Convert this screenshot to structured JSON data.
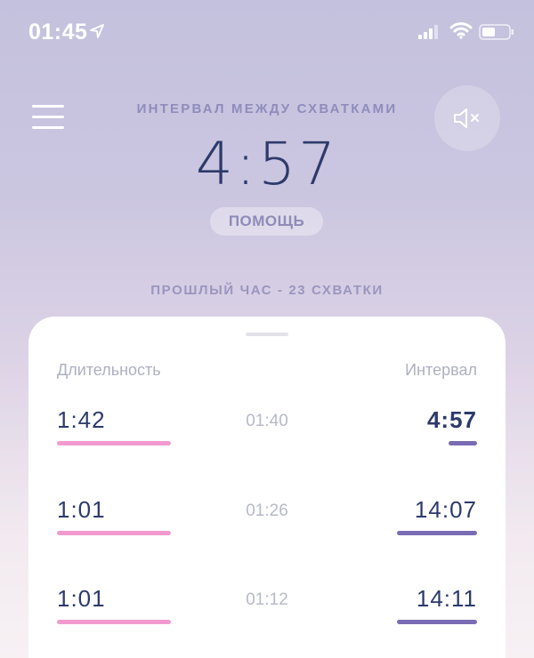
{
  "status_bar": {
    "time": "01:45"
  },
  "header": {
    "interval_label": "ИНТЕРВАЛ МЕЖДУ СХВАТКАМИ",
    "interval_value": "4:57",
    "help_label": "ПОМОЩЬ",
    "last_hour_summary": "ПРОШЛЫЙ ЧАС - 23 СХВАТКИ"
  },
  "table": {
    "duration_header": "Длительность",
    "interval_header": "Интервал",
    "rows": [
      {
        "duration": "1:42",
        "time": "01:40",
        "interval": "4:57"
      },
      {
        "duration": "1:01",
        "time": "01:26",
        "interval": "14:07"
      },
      {
        "duration": "1:01",
        "time": "01:12",
        "interval": "14:11"
      }
    ]
  },
  "colors": {
    "duration_bar": "#f29ace",
    "interval_bar": "#7a6cb4",
    "text_dark": "#2d3a6b"
  },
  "icons": [
    "location-arrow-icon",
    "signal-icon",
    "wifi-icon",
    "battery-icon",
    "menu-icon",
    "speaker-muted-icon"
  ]
}
